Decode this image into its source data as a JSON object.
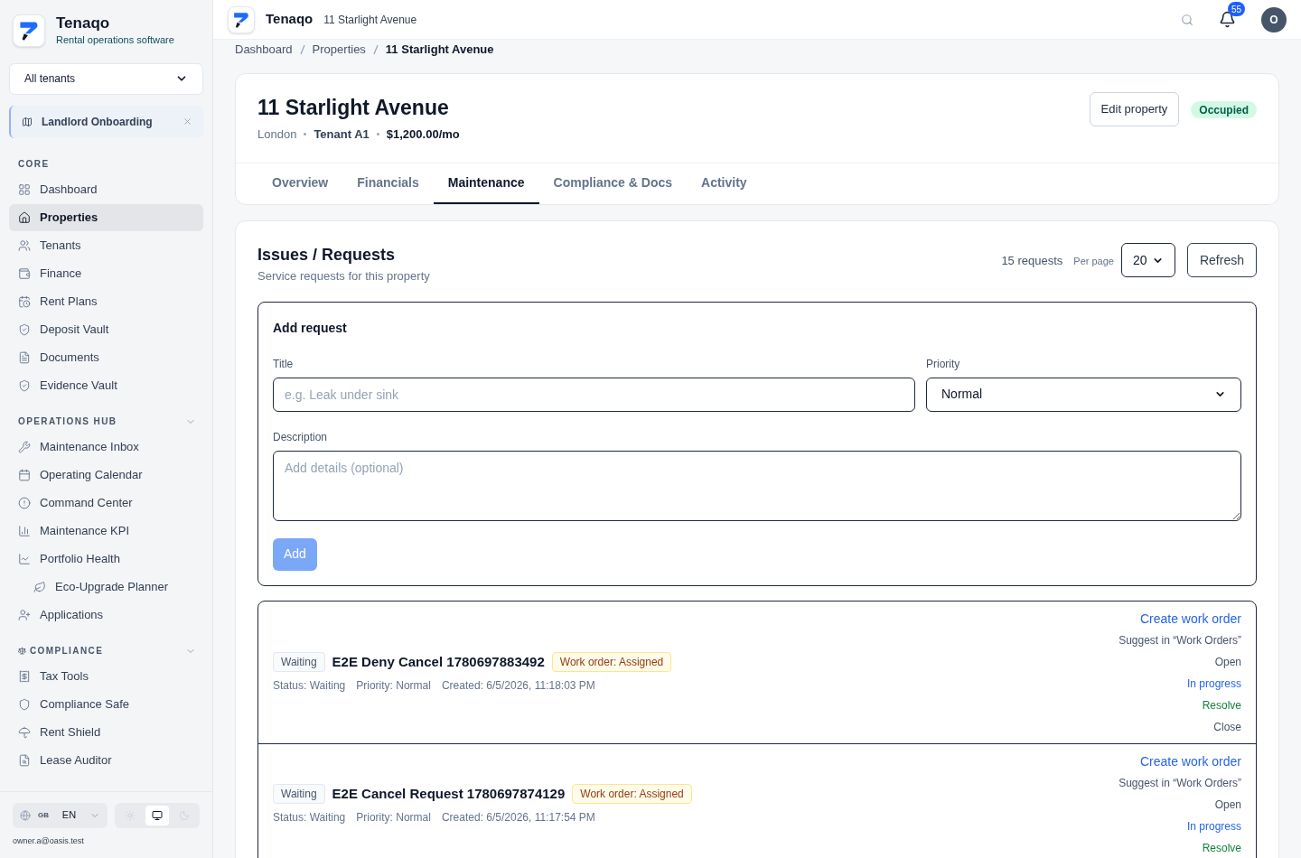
{
  "brand": {
    "name": "Tenaqo",
    "tagline": "Rental operations software"
  },
  "tenant_select": {
    "value": "All tenants"
  },
  "pinned": {
    "label": "Landlord Onboarding"
  },
  "sidebar": {
    "sections": [
      {
        "title": "CORE",
        "collapsible": false,
        "items": [
          {
            "label": "Dashboard",
            "selected": false
          },
          {
            "label": "Properties",
            "selected": true
          },
          {
            "label": "Tenants",
            "selected": false
          },
          {
            "label": "Finance",
            "selected": false
          },
          {
            "label": "Rent Plans",
            "selected": false
          },
          {
            "label": "Deposit Vault",
            "selected": false
          },
          {
            "label": "Documents",
            "selected": false
          },
          {
            "label": "Evidence Vault",
            "selected": false
          }
        ]
      },
      {
        "title": "OPERATIONS HUB",
        "collapsible": true,
        "items": [
          {
            "label": "Maintenance Inbox",
            "selected": false
          },
          {
            "label": "Operating Calendar",
            "selected": false
          },
          {
            "label": "Command Center",
            "selected": false
          },
          {
            "label": "Maintenance KPI",
            "selected": false
          },
          {
            "label": "Portfolio Health",
            "selected": false,
            "children": [
              {
                "label": "Eco-Upgrade Planner",
                "selected": false
              }
            ]
          },
          {
            "label": "Applications",
            "selected": false
          }
        ]
      },
      {
        "title": "COMPLIANCE",
        "collapsible": true,
        "items": [
          {
            "label": "Tax Tools",
            "selected": false
          },
          {
            "label": "Compliance Safe",
            "selected": false
          },
          {
            "label": "Rent Shield",
            "selected": false
          },
          {
            "label": "Lease Auditor",
            "selected": false
          }
        ]
      }
    ]
  },
  "footer": {
    "flag": "GB",
    "language": "EN",
    "themes": [
      {
        "selected": false
      },
      {
        "selected": true
      },
      {
        "selected": false
      }
    ],
    "email": "owner.a@oasis.test"
  },
  "topbar": {
    "brand": "Tenaqo",
    "page": "11 Starlight Avenue",
    "notifications": "55",
    "avatar": "O"
  },
  "breadcrumb": [
    "Dashboard",
    "Properties",
    "11 Starlight Avenue"
  ],
  "property": {
    "title": "11 Starlight Avenue",
    "city": "London",
    "tenant": "Tenant A1",
    "rent": "$1,200.00/mo",
    "edit_button": "Edit property",
    "status": "Occupied"
  },
  "tabs": [
    {
      "label": "Overview",
      "selected": false
    },
    {
      "label": "Financials",
      "selected": false
    },
    {
      "label": "Maintenance",
      "selected": true
    },
    {
      "label": "Compliance & Docs",
      "selected": false
    },
    {
      "label": "Activity",
      "selected": false
    }
  ],
  "requests": {
    "title": "Issues / Requests",
    "subtitle": "Service requests for this property",
    "count": "15 requests",
    "per_page_label": "Per page",
    "per_page": "20",
    "refresh": "Refresh"
  },
  "add_form": {
    "title": "Add request",
    "title_label": "Title",
    "title_placeholder": "e.g. Leak under sink",
    "priority_label": "Priority",
    "priority": "Normal",
    "description_label": "Description",
    "description_placeholder": "Add details (optional)",
    "submit": "Add",
    "submit_disabled": true
  },
  "items": [
    {
      "state": "Waiting",
      "title": "E2E Deny Cancel 1780697883492",
      "work_order": "Work order: Assigned",
      "status": "Status: Waiting",
      "priority": "Priority: Normal",
      "created": "Created: 6/5/2026, 11:18:03 PM",
      "actions": [
        {
          "label": "Create work order",
          "kind": "link"
        },
        {
          "label": "Suggest in “Work Orders”",
          "kind": "plain"
        },
        {
          "label": "Open",
          "kind": "plain"
        },
        {
          "label": "In progress",
          "kind": "link"
        },
        {
          "label": "Resolve",
          "kind": "success"
        },
        {
          "label": "Close",
          "kind": "plain"
        }
      ]
    },
    {
      "state": "Waiting",
      "title": "E2E Cancel Request 1780697874129",
      "work_order": "Work order: Assigned",
      "status": "Status: Waiting",
      "priority": "Priority: Normal",
      "created": "Created: 6/5/2026, 11:17:54 PM",
      "actions": [
        {
          "label": "Create work order",
          "kind": "link"
        },
        {
          "label": "Suggest in “Work Orders”",
          "kind": "plain"
        },
        {
          "label": "Open",
          "kind": "plain"
        },
        {
          "label": "In progress",
          "kind": "link"
        },
        {
          "label": "Resolve",
          "kind": "success"
        }
      ]
    }
  ]
}
